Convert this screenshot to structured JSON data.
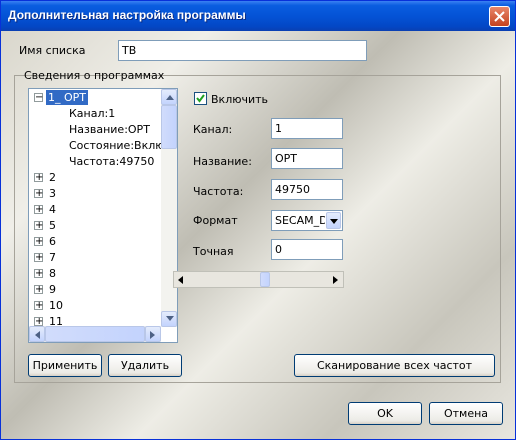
{
  "window": {
    "title": "Дополнительная настройка программы"
  },
  "list_name": {
    "label": "Имя списка",
    "value": "TB"
  },
  "group": {
    "label": "Сведения о программах"
  },
  "tree": {
    "root": {
      "label": "1_ OPT",
      "children": [
        "Канал:1",
        "Название:OPT",
        "Состояние:Включи",
        "Частота:49750"
      ]
    },
    "items": [
      "2",
      "3",
      "4",
      "5",
      "6",
      "7",
      "8",
      "9",
      "10",
      "11"
    ]
  },
  "enable": {
    "label": "Включить",
    "checked": true
  },
  "fields": {
    "channel": {
      "label": "Канал:",
      "value": "1"
    },
    "name": {
      "label": "Название:",
      "value": "OPT"
    },
    "frequency": {
      "label": "Частота:",
      "value": "49750"
    },
    "format": {
      "label": "Формат",
      "value": "SECAM_D"
    },
    "fine": {
      "label": "Точная",
      "value": "0"
    }
  },
  "buttons": {
    "apply": "Применить",
    "delete": "Удалить",
    "scan": "Сканирование всех частот",
    "ok": "OK",
    "cancel": "Отмена"
  },
  "colors": {
    "titlebar": "#0453d6",
    "close": "#c4421e"
  }
}
